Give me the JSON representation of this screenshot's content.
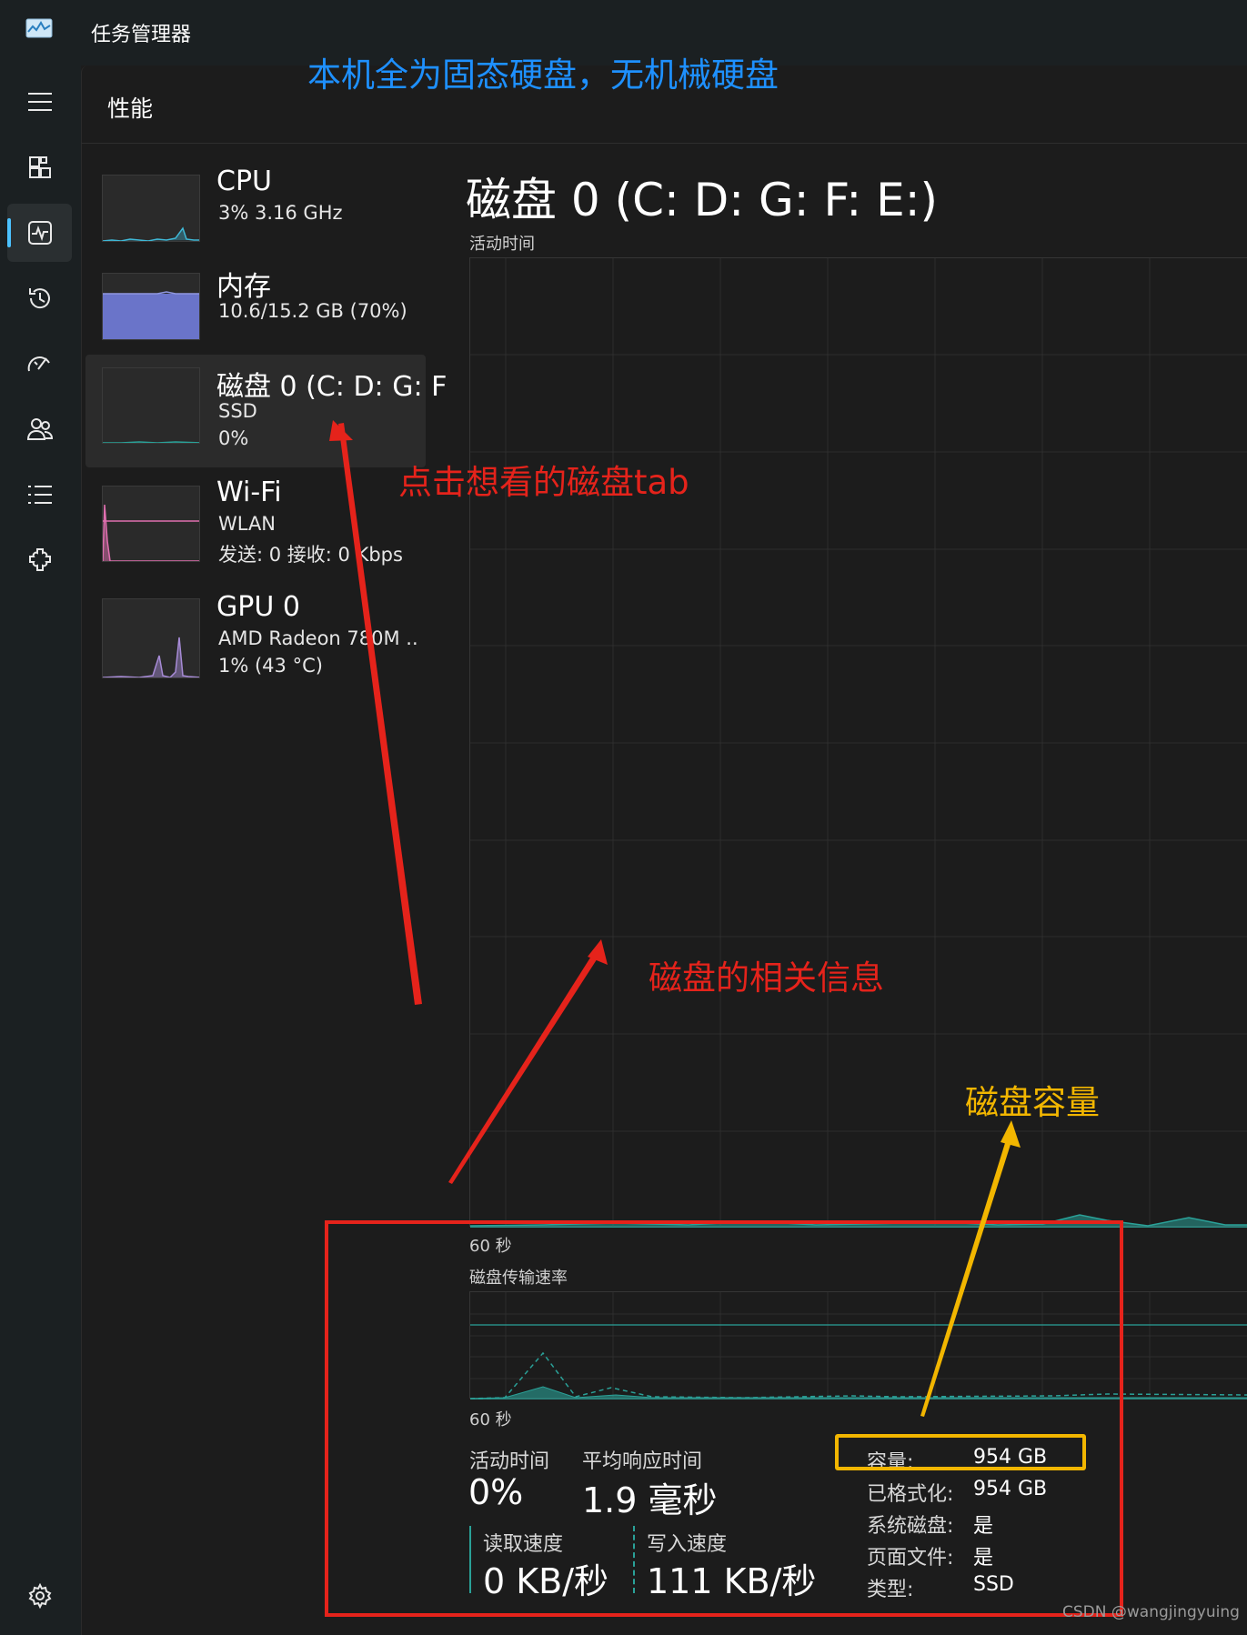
{
  "app": {
    "title": "任务管理器"
  },
  "page": {
    "title": "性能"
  },
  "sidebar_icons": [
    "menu-icon",
    "processes-icon",
    "performance-icon",
    "app-history-icon",
    "startup-icon",
    "users-icon",
    "details-icon",
    "services-icon",
    "settings-icon"
  ],
  "resources": [
    {
      "name": "CPU",
      "line1": "3%  3.16 GHz",
      "line2": ""
    },
    {
      "name": "内存",
      "line1": "10.6/15.2 GB (70%)",
      "line2": ""
    },
    {
      "name": "磁盘 0 (C: D: G: F",
      "line1": "SSD",
      "line2": "0%"
    },
    {
      "name": "Wi-Fi",
      "line1": "WLAN",
      "line2": "发送: 0  接收: 0 Kbps"
    },
    {
      "name": "GPU 0",
      "line1": "AMD Radeon 780M ..",
      "line2": "1%  (43 °C)"
    }
  ],
  "disk": {
    "title": "磁盘 0 (C: D: G: F: E:)",
    "active_time_label": "活动时间",
    "time_axis_label": "60 秒",
    "transfer_label": "磁盘传输速率",
    "time_axis_label2": "60 秒",
    "stats": {
      "active_time": {
        "label": "活动时间",
        "value": "0%"
      },
      "avg_response": {
        "label": "平均响应时间",
        "value": "1.9 毫秒"
      },
      "read_speed": {
        "label": "读取速度",
        "value": "0 KB/秒"
      },
      "write_speed": {
        "label": "写入速度",
        "value": "111 KB/秒"
      }
    },
    "info": [
      {
        "key": "容量:",
        "value": "954 GB"
      },
      {
        "key": "已格式化:",
        "value": "954 GB"
      },
      {
        "key": "系统磁盘:",
        "value": "是"
      },
      {
        "key": "页面文件:",
        "value": "是"
      },
      {
        "key": "类型:",
        "value": "SSD"
      }
    ]
  },
  "annotations": {
    "top_note": "本机全为固态硬盘，无机械硬盘",
    "click_tab": "点击想看的磁盘tab",
    "disk_info": "磁盘的相关信息",
    "capacity": "磁盘容量"
  },
  "colors": {
    "accent": "#4cc2ff",
    "annotation_red": "#e5231b",
    "annotation_yellow": "#f2b600",
    "annotation_blue": "#1e90ff",
    "disk_graph": "#2aa198",
    "memory_fill": "#6a74c9",
    "wifi_line": "#e06fb0",
    "gpu_line": "#a78bd6",
    "cpu_line": "#3fb8d6"
  },
  "watermark": "CSDN @wangjingyuing"
}
